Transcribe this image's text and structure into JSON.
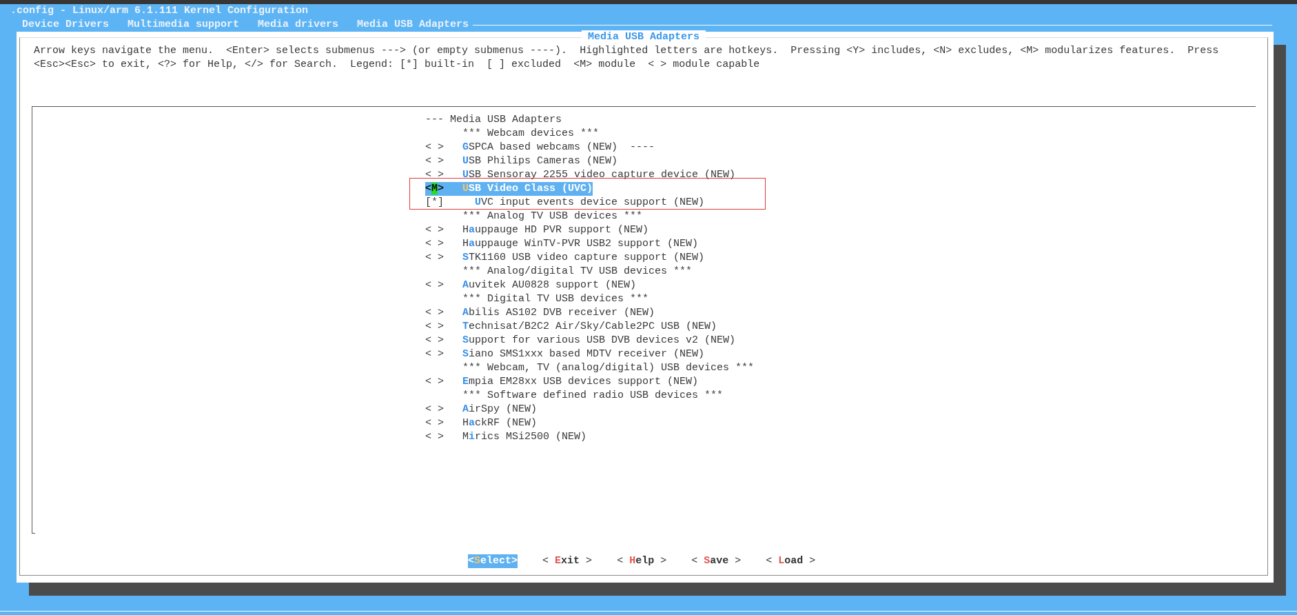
{
  "window": {
    "title": ".config - Linux/arm 6.1.111 Kernel Configuration"
  },
  "breadcrumb": [
    "Device Drivers",
    "Multimedia support",
    "Media drivers",
    "Media USB Adapters"
  ],
  "dialog": {
    "title": "Media USB Adapters",
    "help": "Arrow keys navigate the menu.  <Enter> selects submenus ---> (or empty submenus ----).  Highlighted letters are hotkeys.  Pressing <Y> includes, <N> excludes, <M> modularizes features.  Press <Esc><Esc> to exit, <?> for Help, </> for Search.  Legend: [*] built-in  [ ] excluded  <M> module  < > module capable"
  },
  "menu": {
    "items": [
      {
        "kind": "header",
        "text": "--- Media USB Adapters",
        "selected": false,
        "outlined": false
      },
      {
        "kind": "comment",
        "text": "*** Webcam devices ***",
        "selected": false,
        "outlined": false
      },
      {
        "kind": "option",
        "prefix": "< >",
        "hotkey": "G",
        "after": "SPCA based webcams (NEW)  ----",
        "selected": false,
        "outlined": false
      },
      {
        "kind": "option",
        "prefix": "< >",
        "hotkey": "U",
        "after": "SB Philips Cameras (NEW)",
        "selected": false,
        "outlined": false
      },
      {
        "kind": "option",
        "prefix": "< >",
        "hotkey": "U",
        "after": "SB Sensoray 2255 video capture device (NEW)",
        "selected": false,
        "outlined": false
      },
      {
        "kind": "option",
        "prefix": "<M>",
        "hotkey": "U",
        "after": "SB Video Class (UVC)",
        "selected": true,
        "outlined": true
      },
      {
        "kind": "child",
        "prefix": "[*]",
        "hotkey": "U",
        "after": "VC input events device support (NEW)",
        "selected": false,
        "outlined": true
      },
      {
        "kind": "comment",
        "text": "*** Analog TV USB devices ***",
        "selected": false,
        "outlined": false
      },
      {
        "kind": "option",
        "prefix": "< >",
        "before": "H",
        "hotkey": "a",
        "after": "uppauge HD PVR support (NEW)",
        "selected": false,
        "outlined": false
      },
      {
        "kind": "option",
        "prefix": "< >",
        "before": "H",
        "hotkey": "a",
        "after": "uppauge WinTV-PVR USB2 support (NEW)",
        "selected": false,
        "outlined": false
      },
      {
        "kind": "option",
        "prefix": "< >",
        "hotkey": "S",
        "after": "TK1160 USB video capture support (NEW)",
        "selected": false,
        "outlined": false
      },
      {
        "kind": "comment",
        "text": "*** Analog/digital TV USB devices ***",
        "selected": false,
        "outlined": false
      },
      {
        "kind": "option",
        "prefix": "< >",
        "hotkey": "A",
        "after": "uvitek AU0828 support (NEW)",
        "selected": false,
        "outlined": false
      },
      {
        "kind": "comment",
        "text": "*** Digital TV USB devices ***",
        "selected": false,
        "outlined": false
      },
      {
        "kind": "option",
        "prefix": "< >",
        "hotkey": "A",
        "after": "bilis AS102 DVB receiver (NEW)",
        "selected": false,
        "outlined": false
      },
      {
        "kind": "option",
        "prefix": "< >",
        "hotkey": "T",
        "after": "echnisat/B2C2 Air/Sky/Cable2PC USB (NEW)",
        "selected": false,
        "outlined": false
      },
      {
        "kind": "option",
        "prefix": "< >",
        "hotkey": "S",
        "after": "upport for various USB DVB devices v2 (NEW)",
        "selected": false,
        "outlined": false
      },
      {
        "kind": "option",
        "prefix": "< >",
        "hotkey": "S",
        "after": "iano SMS1xxx based MDTV receiver (NEW)",
        "selected": false,
        "outlined": false
      },
      {
        "kind": "comment",
        "text": "*** Webcam, TV (analog/digital) USB devices ***",
        "selected": false,
        "outlined": false
      },
      {
        "kind": "option",
        "prefix": "< >",
        "hotkey": "E",
        "after": "mpia EM28xx USB devices support (NEW)",
        "selected": false,
        "outlined": false
      },
      {
        "kind": "comment",
        "text": "*** Software defined radio USB devices ***",
        "selected": false,
        "outlined": false
      },
      {
        "kind": "option",
        "prefix": "< >",
        "hotkey": "A",
        "after": "irSpy (NEW)",
        "selected": false,
        "outlined": false
      },
      {
        "kind": "option",
        "prefix": "< >",
        "before": "H",
        "hotkey": "a",
        "after": "ckRF (NEW)",
        "selected": false,
        "outlined": false
      },
      {
        "kind": "option",
        "prefix": "< >",
        "before": "M",
        "hotkey": "i",
        "after": "rics MSi2500 (NEW)",
        "selected": false,
        "outlined": false
      }
    ]
  },
  "buttons": [
    {
      "open": "<",
      "hotkey": "S",
      "rest": "elect",
      "close": ">",
      "selected": true
    },
    {
      "open": "< ",
      "hotkey": "E",
      "rest": "xit",
      "close": " >",
      "selected": false
    },
    {
      "open": "< ",
      "hotkey": "H",
      "rest": "elp",
      "close": " >",
      "selected": false
    },
    {
      "open": "< ",
      "hotkey": "S",
      "rest": "ave",
      "close": " >",
      "selected": false
    },
    {
      "open": "< ",
      "hotkey": "L",
      "rest": "oad",
      "close": " >",
      "selected": false
    }
  ]
}
